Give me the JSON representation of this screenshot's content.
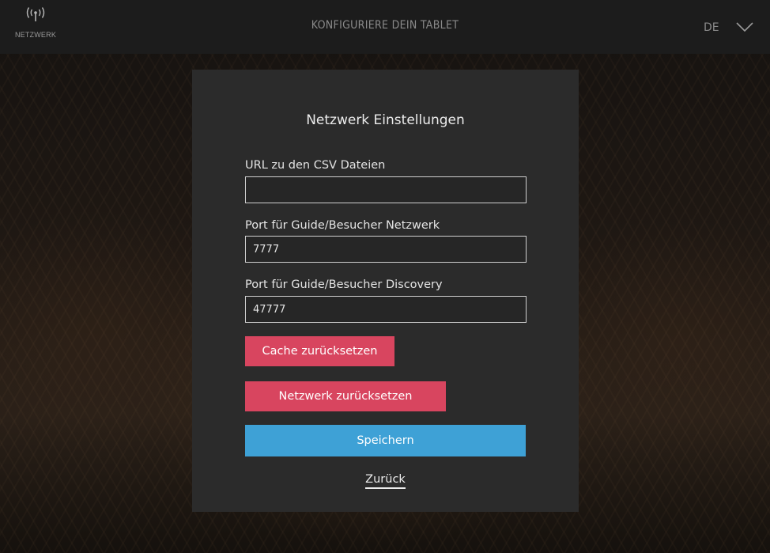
{
  "topbar": {
    "network_label": "NETZWERK",
    "title": "KONFIGURIERE DEIN TABLET",
    "language": "DE",
    "network_icon": "antenna-icon",
    "language_icon": "chevron-down-icon"
  },
  "dialog": {
    "title": "Netzwerk Einstellungen",
    "fields": [
      {
        "label": "URL zu den CSV Dateien",
        "value": ""
      },
      {
        "label": "Port für Guide/Besucher Netzwerk",
        "value": "7777"
      },
      {
        "label": "Port für Guide/Besucher Discovery",
        "value": "47777"
      }
    ],
    "buttons": {
      "reset_cache": "Cache zurücksetzen",
      "reset_network": "Netzwerk zurücksetzen",
      "save": "Speichern",
      "back": "Zurück"
    }
  },
  "colors": {
    "topbar": "#1c1c1c",
    "panel": "#2b2b2b",
    "danger": "#d8455f",
    "primary": "#3ea1d6"
  }
}
